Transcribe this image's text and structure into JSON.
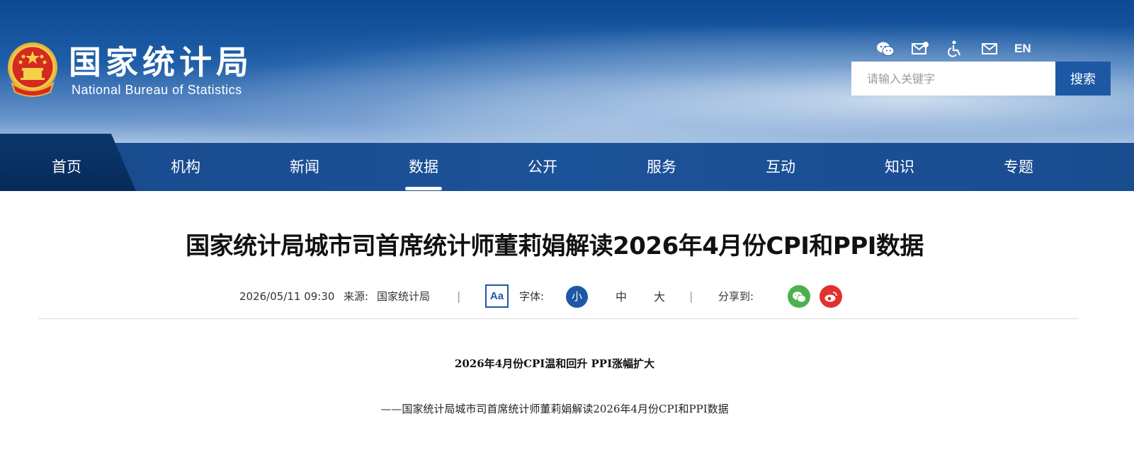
{
  "header": {
    "logo_cn": "国家统计局",
    "logo_en": "National Bureau of Statistics",
    "icons": [
      "wechat-icon",
      "mail-settings-icon",
      "accessibility-icon",
      "mail-icon"
    ],
    "lang_label": "EN",
    "search": {
      "placeholder": "请输入关键字",
      "button": "搜索"
    }
  },
  "nav": {
    "items": [
      "首页",
      "机构",
      "新闻",
      "数据",
      "公开",
      "服务",
      "互动",
      "知识",
      "专题"
    ],
    "active": "数据"
  },
  "article": {
    "title": "国家统计局城市司首席统计师董莉娟解读2026年4月份CPI和PPI数据",
    "date": "2026/05/11 09:30",
    "source_label": "来源:",
    "source": "国家统计局",
    "separator": "|",
    "font_icon": "Aa",
    "font_label": "字体:",
    "font_sizes": [
      "小",
      "中",
      "大"
    ],
    "share_label": "分享到:",
    "subhead": "2026年4月份CPI温和回升  PPI涨幅扩大",
    "subline": "——国家统计局城市司首席统计师董莉娟解读2026年4月份CPI和PPI数据"
  },
  "colors": {
    "brand_blue": "#1d58a5",
    "nav_bg": "#1c5299",
    "wechat_green": "#4cb04c",
    "weibo_red": "#e0312f"
  }
}
